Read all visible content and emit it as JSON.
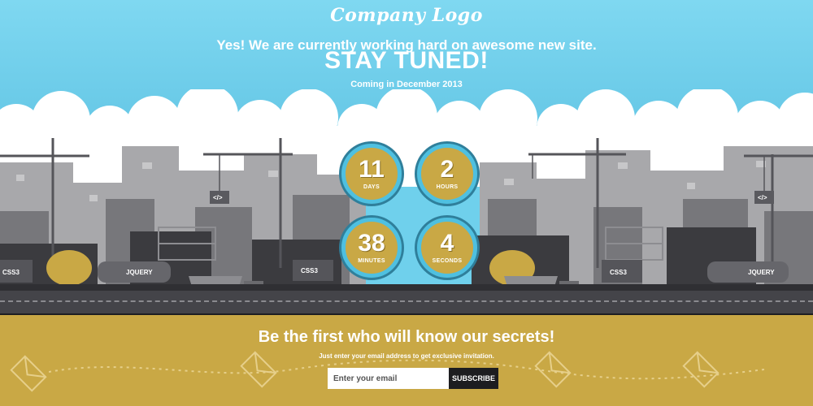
{
  "header": {
    "logo": "Company Logo",
    "headline": "Yes! We are currently working hard on awesome new site.",
    "title": "STAY TUNED!",
    "subtitle": "Coming in December 2013"
  },
  "countdown": [
    {
      "value": "11",
      "label": "DAYS"
    },
    {
      "value": "2",
      "label": "HOURS"
    },
    {
      "value": "38",
      "label": "MINUTES"
    },
    {
      "value": "4",
      "label": "SECONDS"
    }
  ],
  "scene_labels": {
    "css3": "CSS3",
    "jquery": "JQUERY",
    "code": "</>"
  },
  "newsletter": {
    "title": "Be the first who will know our secrets!",
    "subtitle": "Just enter your email address to get exclusive invitation.",
    "email_placeholder": "Enter your email",
    "subscribe_label": "SUBSCRIBE"
  },
  "colors": {
    "sky": "#6fd0ec",
    "ground": "#c9a845",
    "circle_border": "#4fc0e0",
    "button": "#1d1d20"
  }
}
